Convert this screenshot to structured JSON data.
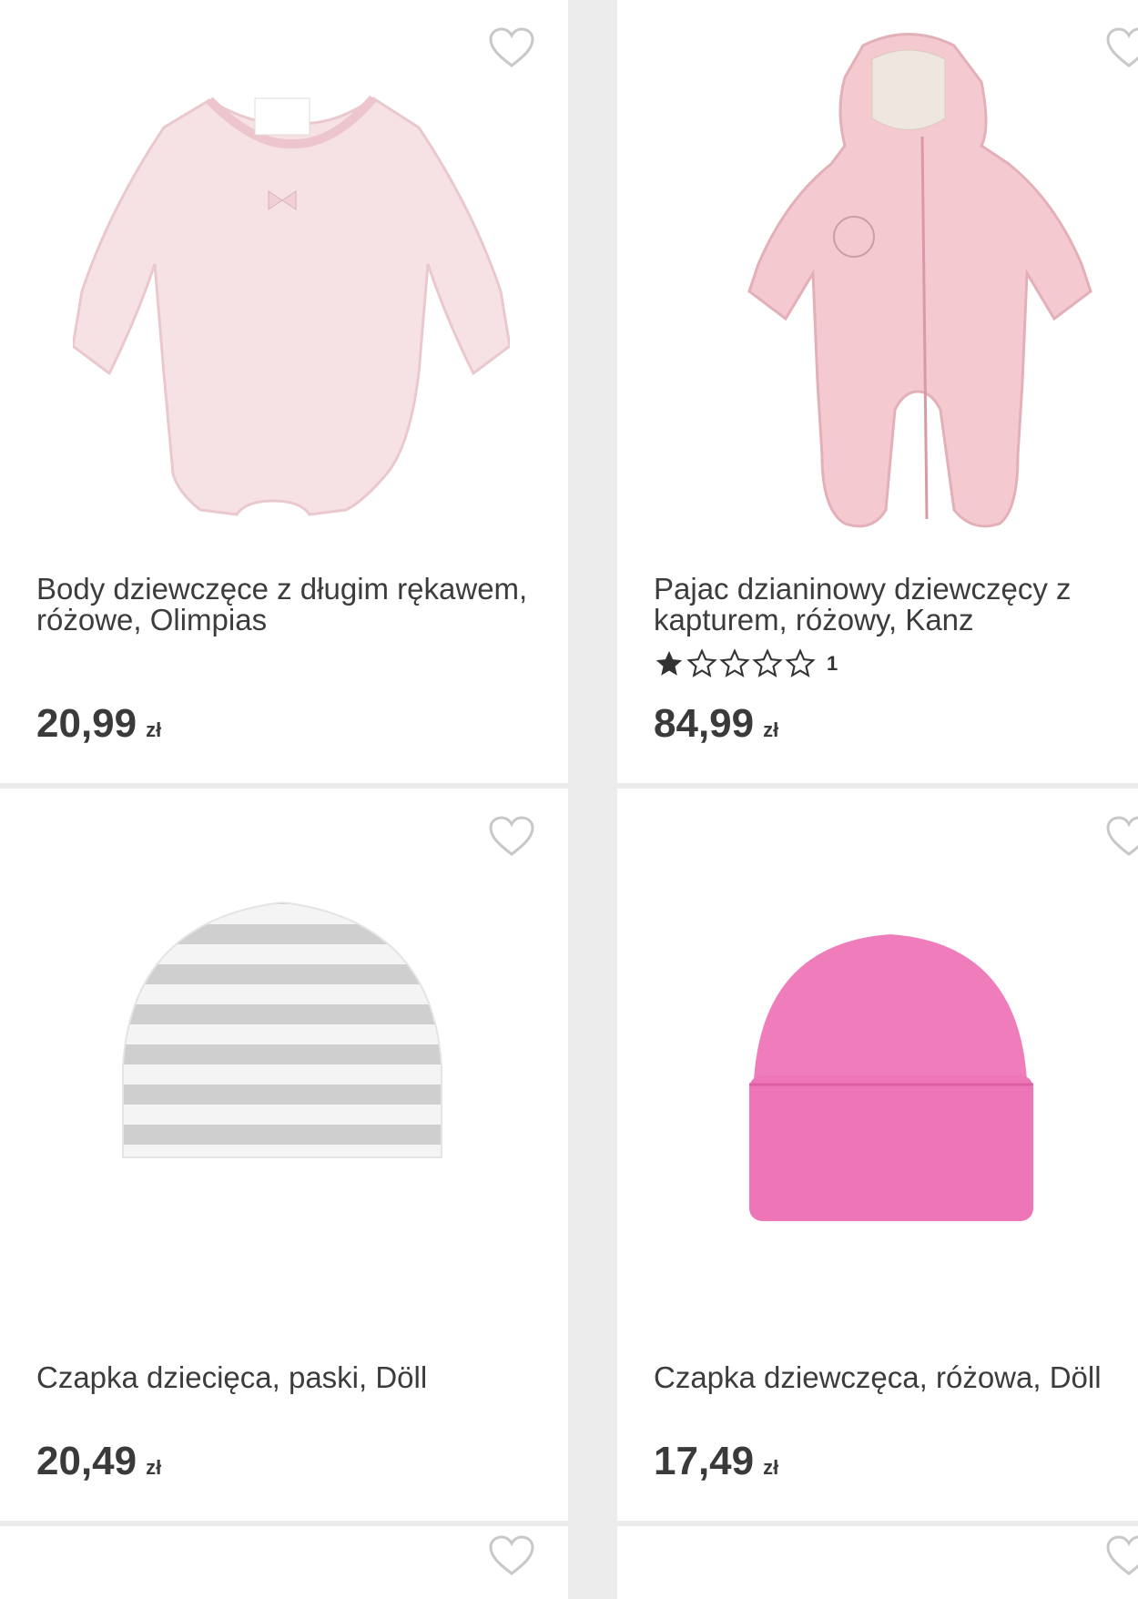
{
  "products": [
    {
      "title": "Body dziewczęce z długim rękawem, różowe, Olimpias",
      "price": "20,99",
      "currency": "zł"
    },
    {
      "title": "Pajac dzianinowy dziewczęcy z kapturem, różowy, Kanz",
      "rating": {
        "stars": 1,
        "max": 5,
        "count": "1"
      },
      "price": "84,99",
      "currency": "zł"
    },
    {
      "title": "Czapka dziecięca, paski, Döll",
      "price": "20,49",
      "currency": "zł"
    },
    {
      "title": "Czapka dziewczęca, różowa, Döll",
      "price": "17,49",
      "currency": "zł"
    }
  ],
  "icons": {
    "wishlist": "heart-outline-icon",
    "star_filled": "star-filled-icon",
    "star_empty": "star-outline-icon"
  },
  "colors": {
    "heart": "#c8c8c8",
    "text": "#3c3c3c",
    "star": "#333333",
    "hat_pink": "#ef7dbc",
    "body_pink": "#f5dde0",
    "suit_pink": "#f4c9cf"
  }
}
